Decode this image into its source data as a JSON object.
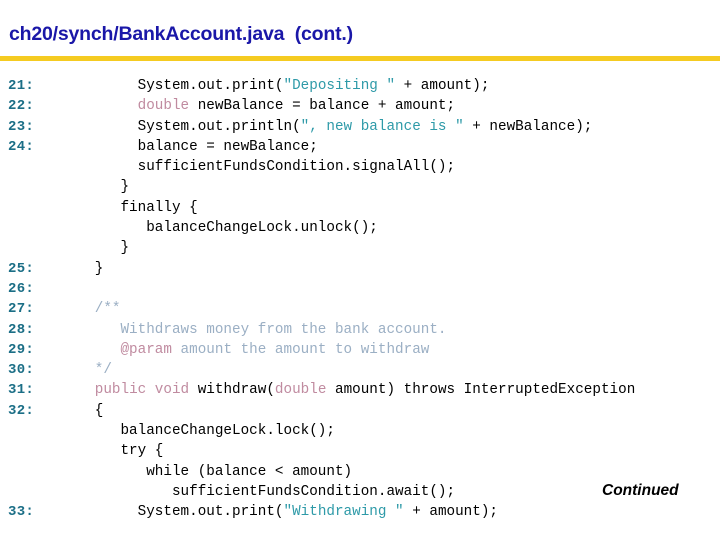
{
  "header": {
    "title": "ch20/synch/Bank.Account. java  (cont.)",
    "title_display": "ch20/synch/BankAccount.java  (cont.)",
    "rule_color": "#F5CB21",
    "title_color": "#1A17A8"
  },
  "palette": {
    "keyword": "#C08BA0",
    "string": "#2E9AA8",
    "comment": "#9BAFC4",
    "line_number": "#1B6E86",
    "plain": "#000000",
    "background": "#FFFFFF"
  },
  "footer": {
    "continued_label": "Continued"
  },
  "code": {
    "language": "java",
    "lines": [
      {
        "number": "21:",
        "tokens": [
          {
            "t": "plain",
            "s": "        System.out.print("
          },
          {
            "t": "string",
            "s": "\"Depositing \""
          },
          {
            "t": "plain",
            "s": " + amount);"
          }
        ]
      },
      {
        "number": "22:",
        "tokens": [
          {
            "t": "plain",
            "s": "        "
          },
          {
            "t": "keyword",
            "s": "double"
          },
          {
            "t": "plain",
            "s": " newBalance = balance + amount;"
          }
        ]
      },
      {
        "number": "23:",
        "tokens": [
          {
            "t": "plain",
            "s": "        System.out.println("
          },
          {
            "t": "string",
            "s": "\", new balance is \""
          },
          {
            "t": "plain",
            "s": " + newBalance);"
          }
        ]
      },
      {
        "number": "24:",
        "tokens": [
          {
            "t": "plain",
            "s": "        balance = newBalance;"
          }
        ]
      },
      {
        "number": "",
        "tokens": [
          {
            "t": "plain",
            "s": "        sufficientFundsCondition.signalAll();"
          }
        ]
      },
      {
        "number": "",
        "tokens": [
          {
            "t": "plain",
            "s": "      }"
          }
        ]
      },
      {
        "number": "",
        "tokens": [
          {
            "t": "plain",
            "s": "      finally {"
          }
        ]
      },
      {
        "number": "",
        "tokens": [
          {
            "t": "plain",
            "s": "         balanceChangeLock.unlock();"
          }
        ]
      },
      {
        "number": "",
        "tokens": [
          {
            "t": "plain",
            "s": "      }"
          }
        ]
      },
      {
        "number": "25:",
        "tokens": [
          {
            "t": "plain",
            "s": "   }"
          }
        ]
      },
      {
        "number": "26:",
        "tokens": [
          {
            "t": "plain",
            "s": ""
          }
        ]
      },
      {
        "number": "27:",
        "tokens": [
          {
            "t": "comment",
            "s": "   /**"
          }
        ]
      },
      {
        "number": "28:",
        "tokens": [
          {
            "t": "comment",
            "s": "      Withdraws money from the bank account."
          }
        ]
      },
      {
        "number": "29:",
        "tokens": [
          {
            "t": "tag",
            "s": "      @param"
          },
          {
            "t": "comment",
            "s": " amount the amount to withdraw"
          }
        ]
      },
      {
        "number": "30:",
        "tokens": [
          {
            "t": "comment",
            "s": "   */"
          }
        ]
      },
      {
        "number": "31:",
        "tokens": [
          {
            "t": "plain",
            "s": "   "
          },
          {
            "t": "keyword",
            "s": "public void"
          },
          {
            "t": "plain",
            "s": " withdraw("
          },
          {
            "t": "keyword",
            "s": "double"
          },
          {
            "t": "plain",
            "s": " amount) throws InterruptedException"
          }
        ]
      },
      {
        "number": "32:",
        "tokens": [
          {
            "t": "plain",
            "s": "   {"
          }
        ]
      },
      {
        "number": "",
        "tokens": [
          {
            "t": "plain",
            "s": "      balanceChangeLock.lock();"
          }
        ]
      },
      {
        "number": "",
        "tokens": [
          {
            "t": "plain",
            "s": "      try {"
          }
        ]
      },
      {
        "number": "",
        "tokens": [
          {
            "t": "plain",
            "s": "         while (balance < amount)"
          }
        ]
      },
      {
        "number": "",
        "tokens": [
          {
            "t": "plain",
            "s": "            sufficientFundsCondition.await();"
          }
        ]
      },
      {
        "number": "33:",
        "tokens": [
          {
            "t": "plain",
            "s": "        System.out.print("
          },
          {
            "t": "string",
            "s": "\"Withdrawing \""
          },
          {
            "t": "plain",
            "s": " + amount);"
          }
        ]
      }
    ]
  }
}
